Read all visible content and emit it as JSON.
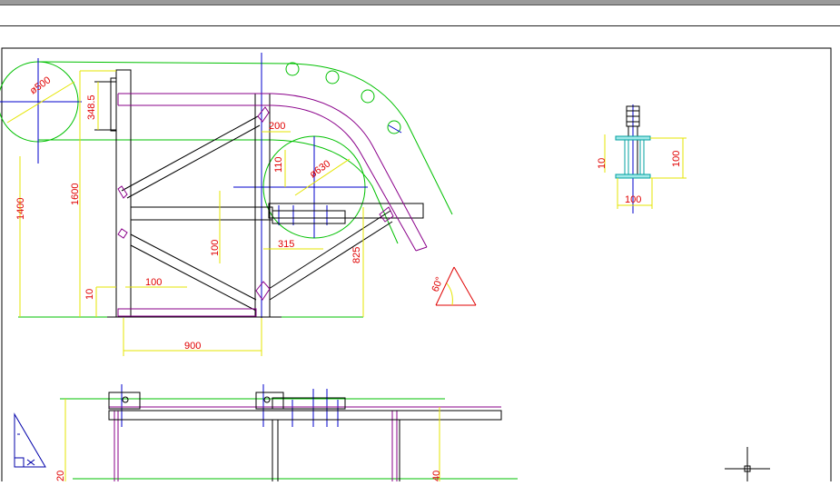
{
  "window": {
    "title": ""
  },
  "drawing": {
    "dimensions": {
      "dia500": "ø500",
      "d348_5": "348.5",
      "d1600": "1600",
      "d1400": "1400",
      "d200": "200",
      "d110": "110",
      "dia630": "ø630",
      "d315": "315",
      "d825": "825",
      "d100_left": "100",
      "d100_mid": "100",
      "d10_left": "10",
      "d900": "900",
      "angle60": "60°",
      "detail_d10": "10",
      "detail_d100_v": "100",
      "detail_d100_h": "100",
      "bottom_d20": "20",
      "bottom_d40": "40"
    },
    "colors": {
      "frame": "#000000",
      "dimension_line": "#e5e500",
      "dimension_text": "#e00000",
      "construction": "#00c000",
      "centerline": "#0000cc",
      "member": "#8a008a",
      "cyan_part": "#00a0a0",
      "ucs_icon": "#0000aa"
    }
  }
}
